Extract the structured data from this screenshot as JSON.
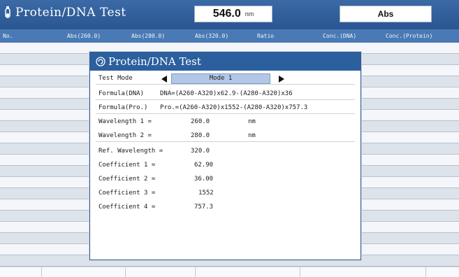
{
  "header": {
    "app_title": "Protein/DNA Test",
    "wavelength_value": "546.0",
    "wavelength_unit": "nm",
    "measure_mode": "Abs"
  },
  "columns": [
    "No.",
    "Abs(260.0)",
    "Abs(280.0)",
    "Abs(320.0)",
    "Ratio",
    "Conc.(DNA)",
    "Conc.(Protein)"
  ],
  "dialog": {
    "title": "Protein/DNA Test",
    "test_mode": {
      "label": "Test Mode",
      "value": "Mode 1"
    },
    "formula_dna": {
      "label": "Formula(DNA)",
      "value": "DNA=(A260-A320)x62.9-(A280-A320)x36"
    },
    "formula_pro": {
      "label": "Formula(Pro.)",
      "value": "Pro.=(A260-A320)x1552-(A280-A320)x757.3"
    },
    "wavelength1": {
      "label": "Wavelength 1 =",
      "value": "260.0",
      "unit": "nm"
    },
    "wavelength2": {
      "label": "Wavelength 2 =",
      "value": "280.0",
      "unit": "nm"
    },
    "ref_wavelength": {
      "label": "Ref. Wavelength =",
      "value": "320.0"
    },
    "coef1": {
      "label": "Coefficient 1 =",
      "value": "62.90"
    },
    "coef2": {
      "label": "Coefficient 2 =",
      "value": "36.00"
    },
    "coef3": {
      "label": "Coefficient 3 =",
      "value": "1552"
    },
    "coef4": {
      "label": "Coefficient 4 =",
      "value": "757.3"
    }
  },
  "colors": {
    "title_bar": "#2c5f9e",
    "header_bar": "#4a7ab5",
    "selection": "#b3c6e6"
  }
}
